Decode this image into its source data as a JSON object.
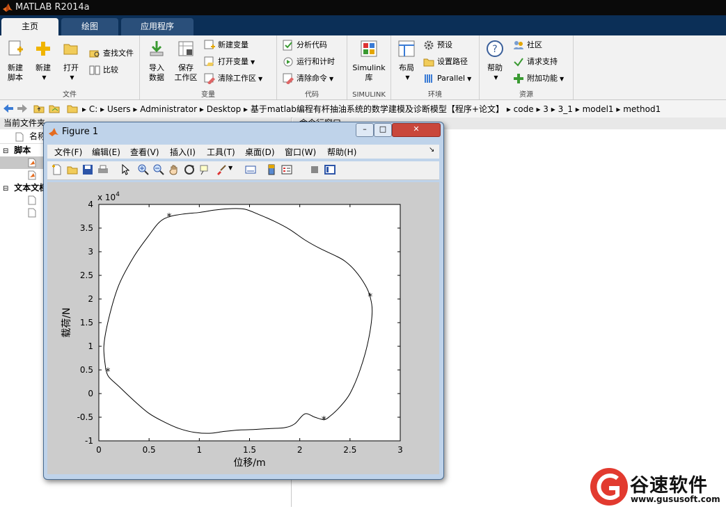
{
  "app": {
    "title": "MATLAB R2014a"
  },
  "tabs": [
    "主页",
    "绘图",
    "应用程序"
  ],
  "ribbon": {
    "file": {
      "label": "文件",
      "new_script": "新建\n脚本",
      "new": "新建",
      "open": "打开",
      "find_files": "查找文件",
      "compare": "比较"
    },
    "variable": {
      "label": "变量",
      "import": "导入\n数据",
      "save_ws": "保存\n工作区",
      "new_var": "新建变量",
      "open_var": "打开变量",
      "clear_ws": "清除工作区"
    },
    "code": {
      "label": "代码",
      "analyze": "分析代码",
      "run_time": "运行和计时",
      "clear_cmd": "清除命令"
    },
    "simulink": {
      "label": "SIMULINK",
      "btn": "Simulink\n库"
    },
    "env": {
      "label": "环境",
      "layout": "布局",
      "prefs": "预设",
      "set_path": "设置路径",
      "parallel": "Parallel"
    },
    "resources": {
      "label": "资源",
      "help": "帮助",
      "community": "社区",
      "support": "请求支持",
      "addons": "附加功能"
    }
  },
  "address": {
    "crumbs": [
      "C:",
      "Users",
      "Administrator",
      "Desktop",
      "基于matlab编程有杆抽油系统的数学建模及诊断模型【程序+论文】",
      "code",
      "3",
      "3_1",
      "model1",
      "method1"
    ]
  },
  "left_panel": {
    "title": "当前文件夹",
    "col_name": "名称",
    "group_scripts": "脚本",
    "group_text": "文本文档"
  },
  "right_panel": {
    "title": "命令行窗口"
  },
  "figure": {
    "title": "Figure 1",
    "menu": [
      "文件(F)",
      "编辑(E)",
      "查看(V)",
      "插入(I)",
      "工具(T)",
      "桌面(D)",
      "窗口(W)",
      "帮助(H)"
    ]
  },
  "chart_data": {
    "type": "line",
    "title": "",
    "xlabel": "位移/m",
    "ylabel": "载荷/N",
    "xlim": [
      0,
      3
    ],
    "ylim": [
      -1,
      4
    ],
    "y_multiplier": "x 10^4",
    "xticks": [
      "0",
      "0.5",
      "1",
      "1.5",
      "2",
      "2.5",
      "3"
    ],
    "yticks": [
      "-1",
      "-0.5",
      "0",
      "0.5",
      "1",
      "1.5",
      "2",
      "2.5",
      "3",
      "3.5",
      "4"
    ],
    "series": [
      {
        "x": [
          0.07,
          0.05,
          0.1,
          0.2,
          0.35,
          0.5,
          0.6,
          0.7,
          0.85,
          1.0,
          1.15,
          1.3,
          1.45,
          1.6,
          1.75,
          1.9,
          2.05,
          2.2,
          2.35,
          2.45,
          2.55,
          2.65,
          2.7,
          2.72,
          2.68,
          2.6,
          2.5,
          2.4,
          2.3,
          2.24,
          2.15,
          2.05,
          1.95,
          1.85,
          1.7,
          1.55,
          1.4,
          1.25,
          1.1,
          0.95,
          0.8,
          0.65,
          0.5,
          0.35,
          0.2,
          0.1,
          0.07
        ],
        "y": [
          0.5,
          1.0,
          1.6,
          2.3,
          2.9,
          3.35,
          3.62,
          3.74,
          3.8,
          3.83,
          3.88,
          3.91,
          3.9,
          3.78,
          3.64,
          3.47,
          3.25,
          3.07,
          2.92,
          2.8,
          2.6,
          2.3,
          2.05,
          1.7,
          1.1,
          0.5,
          0.0,
          -0.28,
          -0.48,
          -0.55,
          -0.5,
          -0.43,
          -0.64,
          -0.72,
          -0.74,
          -0.76,
          -0.77,
          -0.8,
          -0.84,
          -0.82,
          -0.74,
          -0.6,
          -0.42,
          -0.15,
          0.15,
          0.35,
          0.5
        ]
      }
    ],
    "markers": {
      "x": [
        0.7,
        0.09,
        2.7,
        2.24
      ],
      "y": [
        3.74,
        0.47,
        2.05,
        -0.55
      ],
      "symbol": "*"
    }
  },
  "watermark": {
    "brand": "谷速软件",
    "url": "www.gususoft.com"
  }
}
